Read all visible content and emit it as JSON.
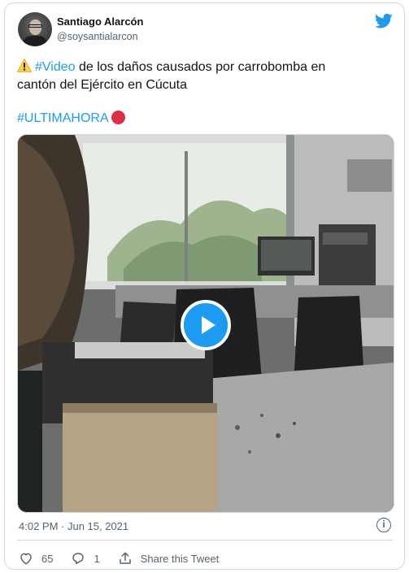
{
  "author": {
    "name": "Santiago Alarcón",
    "handle": "@soysantialarcon"
  },
  "tweet": {
    "hashtag_video": "#Video",
    "text_line1_rest": " de los daños causados por carrobomba en",
    "text_line2": "cantón del Ejército en Cúcuta",
    "hashtag_breaking": "#ULTIMAHORA"
  },
  "icons": {
    "twitter_logo": "twitter-bird-icon",
    "warning": "warning-emoji",
    "red_circle": "red-circle-emoji",
    "play": "play-icon",
    "info": "info-icon",
    "like": "heart-icon",
    "reply": "reply-icon",
    "share": "share-icon"
  },
  "footer": {
    "timestamp": "4:02 PM · Jun 15, 2021",
    "info_glyph": "i"
  },
  "actions": {
    "likes": "65",
    "replies": "1",
    "share_label": "Share this Tweet"
  },
  "colors": {
    "accent": "#1d9bf0",
    "text_secondary": "#536471",
    "border": "#cfd9de",
    "red": "#dd2e44"
  }
}
